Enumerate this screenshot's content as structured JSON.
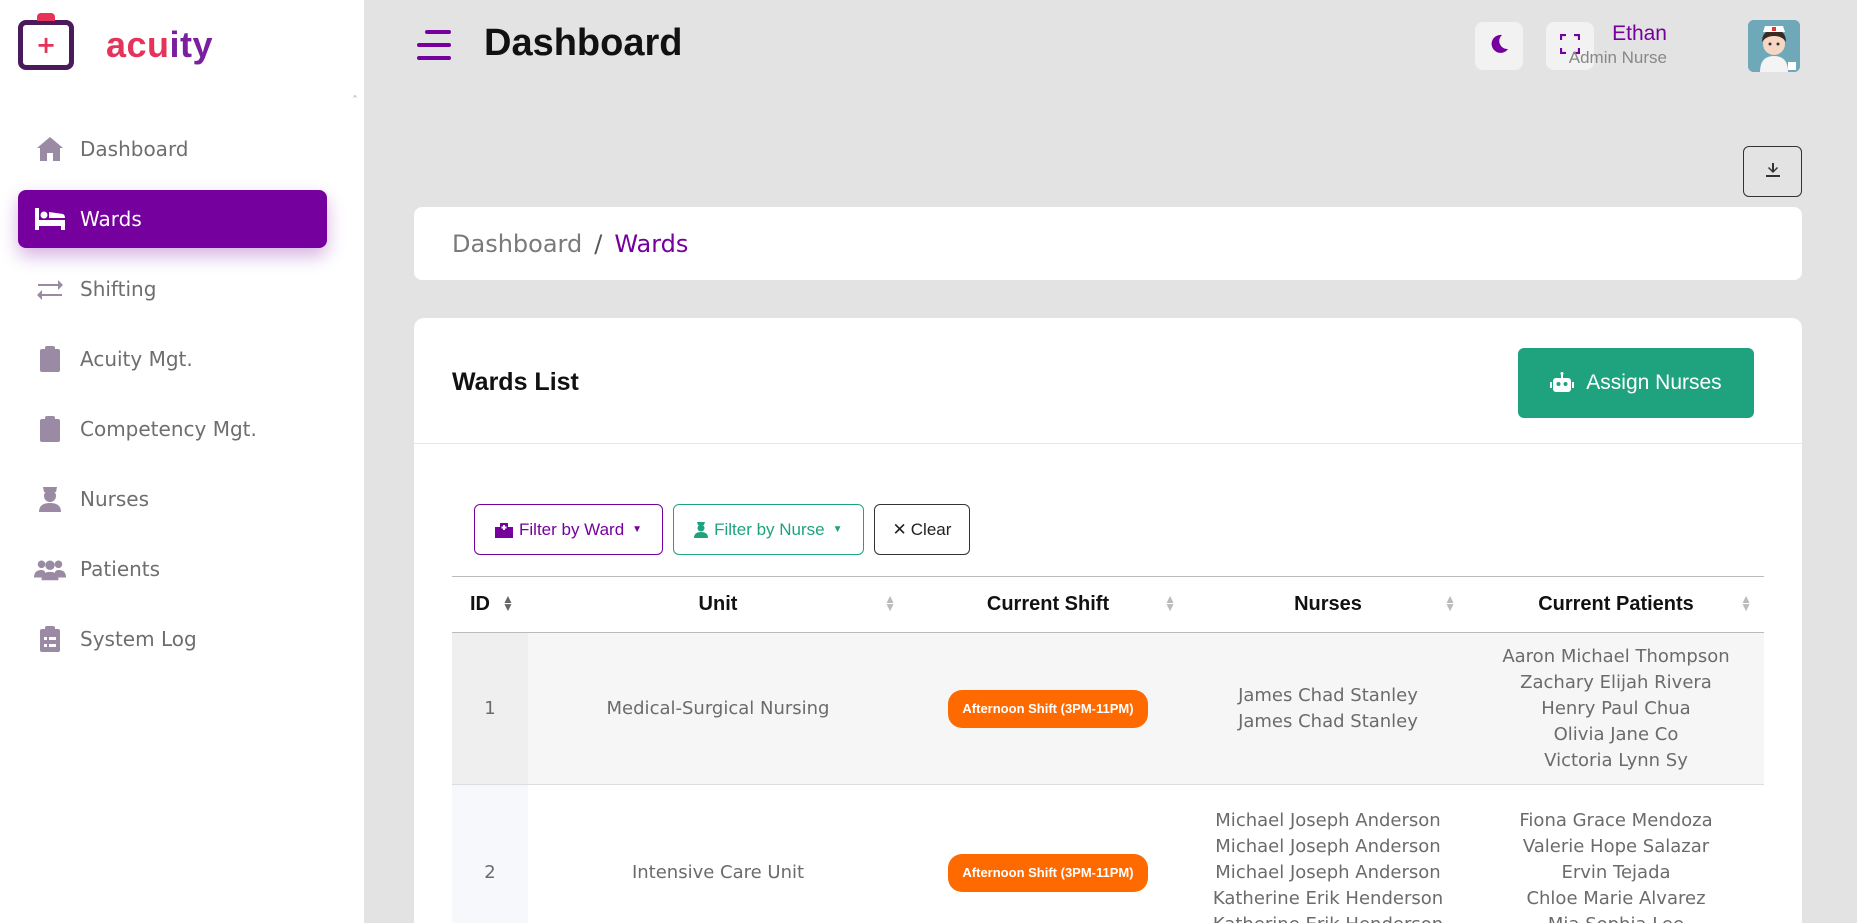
{
  "app": {
    "logo_text_a": "acu",
    "logo_text_b": "ity"
  },
  "sidebar": {
    "items": [
      {
        "label": "Dashboard",
        "icon": "home-icon",
        "active": false
      },
      {
        "label": "Wards",
        "icon": "bed-icon",
        "active": true
      },
      {
        "label": "Shifting",
        "icon": "swap-arrows-icon",
        "active": false
      },
      {
        "label": "Acuity Mgt.",
        "icon": "clipboard-icon",
        "active": false
      },
      {
        "label": "Competency Mgt.",
        "icon": "clipboard-icon",
        "active": false
      },
      {
        "label": "Nurses",
        "icon": "nurse-icon",
        "active": false
      },
      {
        "label": "Patients",
        "icon": "users-icon",
        "active": false
      },
      {
        "label": "System Log",
        "icon": "clipboard-list-icon",
        "active": false
      }
    ]
  },
  "header": {
    "title": "Dashboard",
    "user_name": "Ethan",
    "user_role": "Admin Nurse"
  },
  "breadcrumb": {
    "home": "Dashboard",
    "separator": "/",
    "current": "Wards"
  },
  "card": {
    "title": "Wards List",
    "assign_label": "Assign Nurses"
  },
  "filters": {
    "ward_label": "Filter by Ward",
    "nurse_label": "Filter by Nurse",
    "clear_label": "Clear",
    "clear_icon": "✕"
  },
  "table": {
    "columns": [
      "ID",
      "Unit",
      "Current Shift",
      "Nurses",
      "Current Patients"
    ],
    "rows": [
      {
        "id": "1",
        "unit": "Medical-Surgical Nursing",
        "shift": "Afternoon Shift (3PM-11PM)",
        "nurses": [
          "James Chad Stanley",
          "James Chad Stanley"
        ],
        "patients": [
          "Aaron Michael Thompson",
          "Zachary Elijah Rivera",
          "Henry Paul Chua",
          "Olivia Jane Co",
          "Victoria Lynn Sy"
        ]
      },
      {
        "id": "2",
        "unit": "Intensive Care Unit",
        "shift": "Afternoon Shift (3PM-11PM)",
        "nurses": [
          "Michael Joseph Anderson",
          "Michael Joseph Anderson",
          "Michael Joseph Anderson",
          "Katherine Erik Henderson",
          "Katherine Erik Henderson"
        ],
        "patients": [
          "Fiona Grace Mendoza",
          "Valerie Hope Salazar",
          "Ervin Tejada",
          "Chloe Marie Alvarez",
          "Mia Sophia Lee"
        ]
      }
    ]
  },
  "colors": {
    "brand": "#76009e",
    "accent": "#e5335a",
    "success": "#1fa37f",
    "shift_badge": "#ff6a00"
  }
}
